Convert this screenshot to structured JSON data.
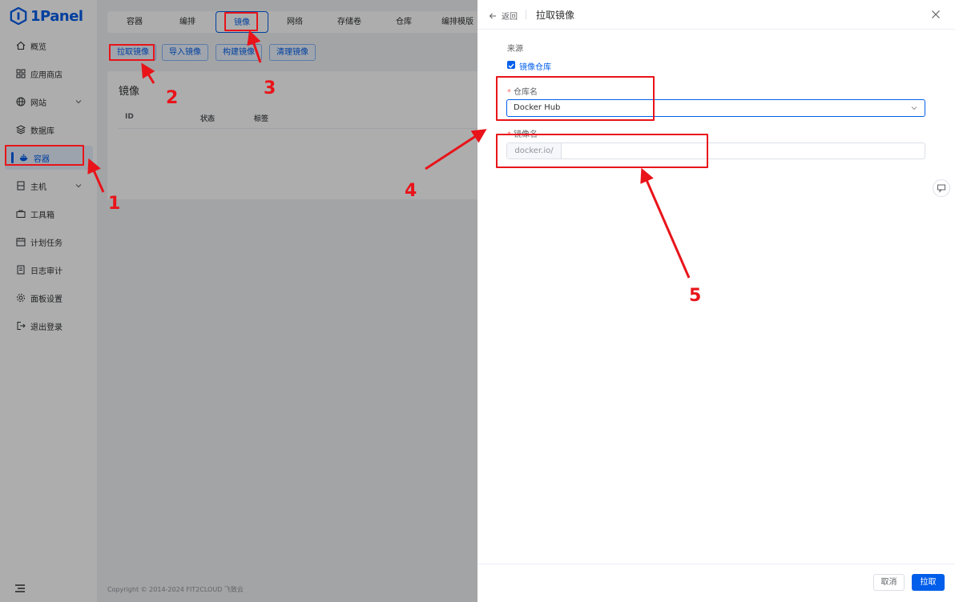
{
  "app": {
    "logo_text": "1Panel"
  },
  "sidebar": {
    "items": [
      {
        "label": "概览",
        "icon": "home-icon"
      },
      {
        "label": "应用商店",
        "icon": "grid-icon"
      },
      {
        "label": "网站",
        "icon": "globe-icon",
        "expandable": true
      },
      {
        "label": "数据库",
        "icon": "layers-icon"
      },
      {
        "label": "容器",
        "icon": "docker-icon",
        "active": true
      },
      {
        "label": "主机",
        "icon": "server-icon",
        "expandable": true
      },
      {
        "label": "工具箱",
        "icon": "toolbox-icon"
      },
      {
        "label": "计划任务",
        "icon": "calendar-icon"
      },
      {
        "label": "日志审计",
        "icon": "log-icon"
      },
      {
        "label": "面板设置",
        "icon": "gear-icon"
      },
      {
        "label": "退出登录",
        "icon": "logout-icon"
      }
    ]
  },
  "tabs": [
    {
      "label": "容器"
    },
    {
      "label": "编排"
    },
    {
      "label": "镜像",
      "active": true
    },
    {
      "label": "网络"
    },
    {
      "label": "存储卷"
    },
    {
      "label": "仓库"
    },
    {
      "label": "编排模版"
    }
  ],
  "actions": {
    "pull": "拉取镜像",
    "import": "导入镜像",
    "build": "构建镜像",
    "prune": "清理镜像"
  },
  "card": {
    "title": "镜像",
    "columns": [
      "ID",
      "状态",
      "标签"
    ]
  },
  "footer": {
    "copyright": "Copyright © 2014-2024 FIT2CLOUD 飞致云"
  },
  "drawer": {
    "back_label": "返回",
    "title": "拉取镜像",
    "source_label": "来源",
    "source_option": "镜像仓库",
    "source_checked": true,
    "repo_label": "仓库名",
    "repo_value": "Docker Hub",
    "image_label": "镜像名",
    "image_prefix": "docker.io/",
    "image_value": "",
    "cancel_label": "取消",
    "submit_label": "拉取"
  },
  "annotations": {
    "color": "#e8141a",
    "numbers": [
      "1",
      "2",
      "3",
      "4",
      "5"
    ]
  },
  "colors": {
    "primary": "#005eeb"
  }
}
